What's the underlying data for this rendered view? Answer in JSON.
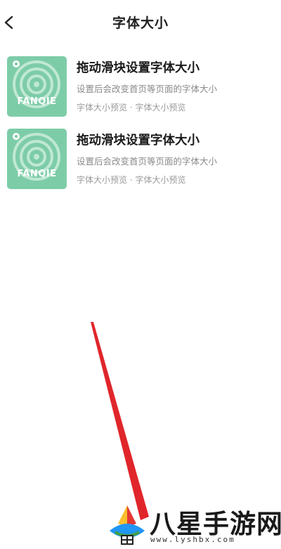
{
  "header": {
    "title": "字体大小",
    "back_icon": "chevron-left-icon"
  },
  "list": {
    "items": [
      {
        "title": "拖动滑块设置字体大小",
        "subtitle": "设置后会改变首页等页面的字体大小",
        "meta": "字体大小预览 · 字体大小预览",
        "cover_brand": "FANQIE",
        "cover_color": "#7dcca8"
      },
      {
        "title": "拖动滑块设置字体大小",
        "subtitle": "设置后会改变首页等页面的字体大小",
        "meta": "字体大小预览 · 字体大小预览",
        "cover_brand": "FANQIE",
        "cover_color": "#7dcca8"
      }
    ]
  },
  "annotation": {
    "color": "#e0262b"
  },
  "watermark": {
    "text": "八星手游网",
    "url": "www.lyshbx.com"
  }
}
